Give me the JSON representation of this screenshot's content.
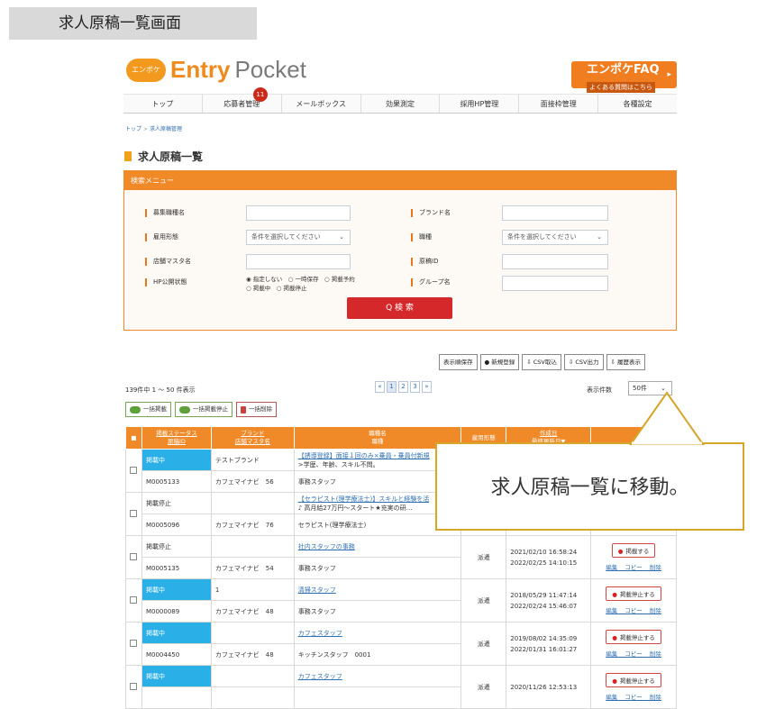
{
  "page_tag": "求人原稿一覧画面",
  "logo": {
    "oval_text": "エンポケ",
    "brand_entry": "Entry",
    "brand_pocket": "Pocket"
  },
  "faq": {
    "title": "エンポケFAQ",
    "sub": "よくある質問はこちら",
    "arrow": "▸"
  },
  "nav": {
    "items": [
      "トップ",
      "応募者管理",
      "メールボックス",
      "効果測定",
      "採用HP管理",
      "面接枠管理",
      "各種設定"
    ],
    "badge": "11"
  },
  "breadcrumb": {
    "home": "トップ",
    "sep": ">",
    "current": "求人原稿管理"
  },
  "heading": "求人原稿一覧",
  "search": {
    "header": "検索メニュー",
    "labels": {
      "job_type": "募集職種名",
      "brand": "ブランド名",
      "employment": "雇用形態",
      "occupation": "職種",
      "store_master": "店舗マスタ名",
      "draft_id": "原稿ID",
      "hp_status": "HP公開状態",
      "group": "グループ名"
    },
    "select_placeholder": "条件を選択してください",
    "radio_options": "◉ 指定しない　○ 一時保存　○ 掲載予約",
    "radio_options_2": "○ 掲載中　○ 掲載停止",
    "button": "Q 検 索"
  },
  "actions": [
    "表示順保存",
    "● 新規登録",
    "⇩ CSV取込",
    "⇩ CSV出力",
    "⇩ 履歴表示"
  ],
  "results": {
    "count_text": "139件中 1 ～ 50 件表示",
    "pager": [
      "«",
      "1",
      "2",
      "3",
      "»"
    ],
    "perpage_label": "表示件数",
    "perpage_value": "50件"
  },
  "bulk": [
    "一括掲載",
    "一括掲載停止",
    "一括削除"
  ],
  "table": {
    "headers": {
      "status": "掲載ステータス",
      "draft_id": "原稿ID",
      "brand": "ブランド",
      "store_master": "店舗マスタ名",
      "job_name": "職種名",
      "occupation": "職種",
      "employment": "雇用形態",
      "created": "作成日",
      "updated": "最終更新日▼"
    },
    "rows": [
      {
        "status": "掲載中",
        "status_blue": true,
        "brand": "テストブランド",
        "title": "【誘導登録】面接１回のみ×乗員・乗員付新規",
        "title2": ">学歴、年齢、スキル不問。",
        "id": "M0005133",
        "store": "カフェマイナビ　56",
        "occ": "事務スタッフ",
        "emp": "",
        "created": "",
        "updated": "",
        "op": ""
      },
      {
        "status": "掲載停止",
        "status_blue": false,
        "brand": "",
        "title": "【セラピスト(理学療法士)】スキルと経験を活",
        "title2": "♪ 高月給27万円〜スタート★充実の研…",
        "id": "M0005096",
        "store": "カフェマイナビ　76",
        "occ": "セラピスト(理学療法士)",
        "emp": "",
        "created": "",
        "updated": "",
        "op": ""
      },
      {
        "status": "掲載停止",
        "status_blue": false,
        "brand": "",
        "title": "社内スタッフの事務",
        "title2": "",
        "id": "M0005135",
        "store": "カフェマイナビ　54",
        "occ": "事務スタッフ",
        "emp": "派遣",
        "created": "2021/02/10 16:58:24",
        "updated": "2022/02/25 14:10:15",
        "op": "掲載する"
      },
      {
        "status": "掲載中",
        "status_blue": true,
        "brand": "1",
        "title": "清掃スタッフ",
        "title2": "",
        "id": "M0000089",
        "store": "カフェマイナビ　48",
        "occ": "事務スタッフ",
        "emp": "派遣",
        "created": "2018/05/29 11:47:14",
        "updated": "2022/02/24 15:46:07",
        "op": "掲載停止する"
      },
      {
        "status": "掲載中",
        "status_blue": true,
        "brand": "",
        "title": "カフェスタッフ",
        "title2": "",
        "id": "M0004450",
        "store": "カフェマイナビ　48",
        "occ": "キッチンスタッフ　0001",
        "emp": "派遣",
        "created": "2019/08/02 14:35:09",
        "updated": "2022/01/31 16:01:27",
        "op": "掲載停止する"
      },
      {
        "status": "掲載中",
        "status_blue": true,
        "brand": "",
        "title": "カフェスタッフ",
        "title2": "",
        "id": "",
        "store": "",
        "occ": "",
        "emp": "派遣",
        "created": "2020/11/26 12:53:13",
        "updated": "",
        "op": "掲載停止する"
      }
    ],
    "op_links": "編集 コピー 削除"
  },
  "callout": "求人原稿一覧に移動。",
  "colors": {
    "accent": "#f08a28",
    "status_blue": "#2ab0e6",
    "danger": "#d5282b",
    "callout_border": "#d7a52a"
  }
}
